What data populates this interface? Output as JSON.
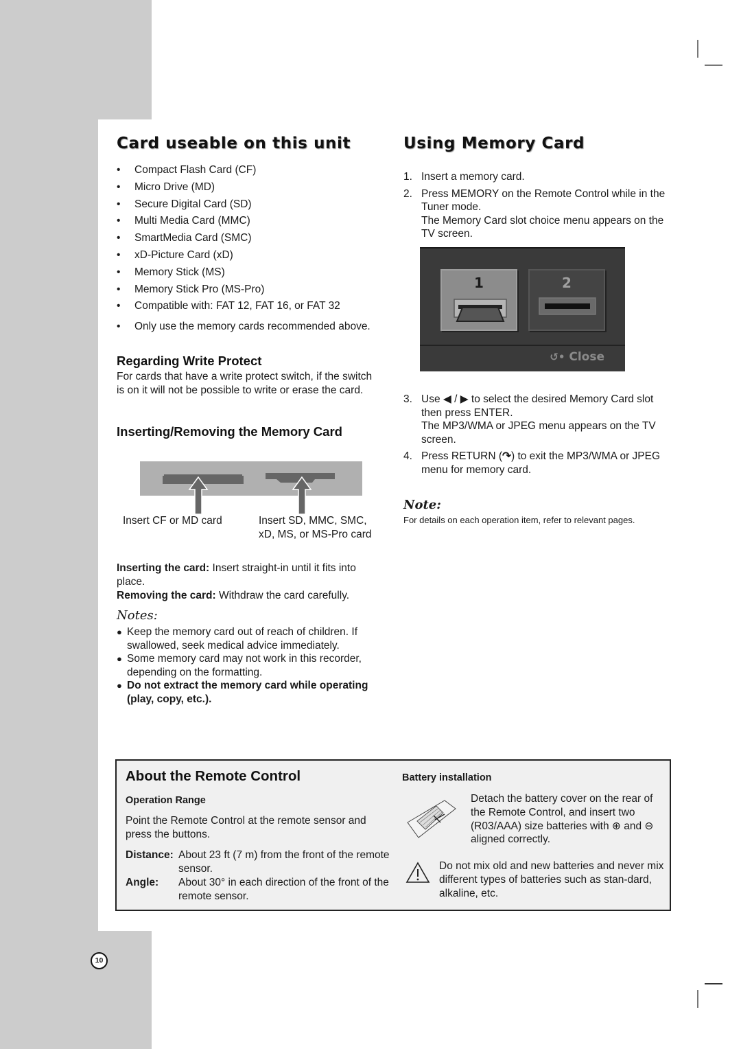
{
  "left": {
    "title": "Card useable on this unit",
    "cards": [
      "Compact Flash Card (CF)",
      "Micro Drive (MD)",
      "Secure Digital Card (SD)",
      "Multi Media Card (MMC)",
      "SmartMedia Card (SMC)",
      "xD-Picture Card (xD)",
      "Memory Stick (MS)",
      "Memory Stick Pro (MS-Pro)",
      "Compatible with: FAT 12, FAT 16, or FAT 32"
    ],
    "only_use": "Only use the memory cards recommended above.",
    "write_protect": {
      "heading": "Regarding Write Protect",
      "body": "For cards that have a write protect switch, if the switch is on it will not be possible to write or erase the card."
    },
    "inserting": {
      "heading": "Inserting/Removing the Memory Card",
      "label_left": "Insert CF or MD card",
      "label_right_1": "Insert SD, MMC, SMC,",
      "label_right_2": "xD, MS, or MS-Pro card",
      "insert_bold": "Inserting the card:",
      "insert_text": " Insert straight-in until it fits into place.",
      "remove_bold": "Removing the card:",
      "remove_text": " Withdraw the card carefully."
    },
    "notes": {
      "title": "Notes:",
      "items": [
        "Keep the memory card out of reach of children. If swallowed, seek medical advice immediately.",
        "Some memory card may not work in this recorder, depending on the formatting."
      ],
      "bold_item": "Do not extract the memory card while operating (play, copy, etc.)."
    }
  },
  "right": {
    "title": "Using Memory Card",
    "steps": [
      {
        "num": "1.",
        "text": "Insert a memory card."
      },
      {
        "num": "2.",
        "text": "Press MEMORY on the Remote Control while in the Tuner mode.",
        "sub": "The Memory Card slot choice menu appears on the TV screen."
      }
    ],
    "steps2": [
      {
        "num": "3.",
        "text": "Use ◀ / ▶ to select the desired Memory Card slot then press ENTER.",
        "sub": "The MP3/WMA or JPEG menu appears on the TV screen."
      },
      {
        "num": "4.",
        "text_a": "Press RETURN (",
        "text_b": ") to exit the MP3/WMA or JPEG menu for memory card."
      }
    ],
    "menu": {
      "slot1": "1",
      "slot2": "2",
      "close": "Close",
      "selected_slot": 1
    },
    "note": {
      "title": "Note:",
      "text": "For details on each operation item, refer to relevant pages."
    }
  },
  "remote": {
    "title": "About the Remote Control",
    "range_heading": "Operation Range",
    "range_text": "Point the Remote Control at the remote sensor and press the buttons.",
    "distance_label": "Distance:",
    "distance_text": "About 23 ft (7 m) from the front of the remote sensor.",
    "angle_label": "Angle:",
    "angle_text": "About 30° in each direction of the front of the remote sensor.",
    "battery_heading": "Battery installation",
    "battery_text_a": "Detach the battery cover on the rear of the Remote Control, and insert two (R03/AAA) size batteries with ",
    "battery_plus": "⊕",
    "battery_text_b": " and ",
    "battery_minus": "⊖",
    "battery_text_c": " aligned correctly.",
    "warning_text": "Do not mix old and new batteries and never mix different types of batteries such as stan-dard, alkaline, etc."
  },
  "page_number": "10"
}
